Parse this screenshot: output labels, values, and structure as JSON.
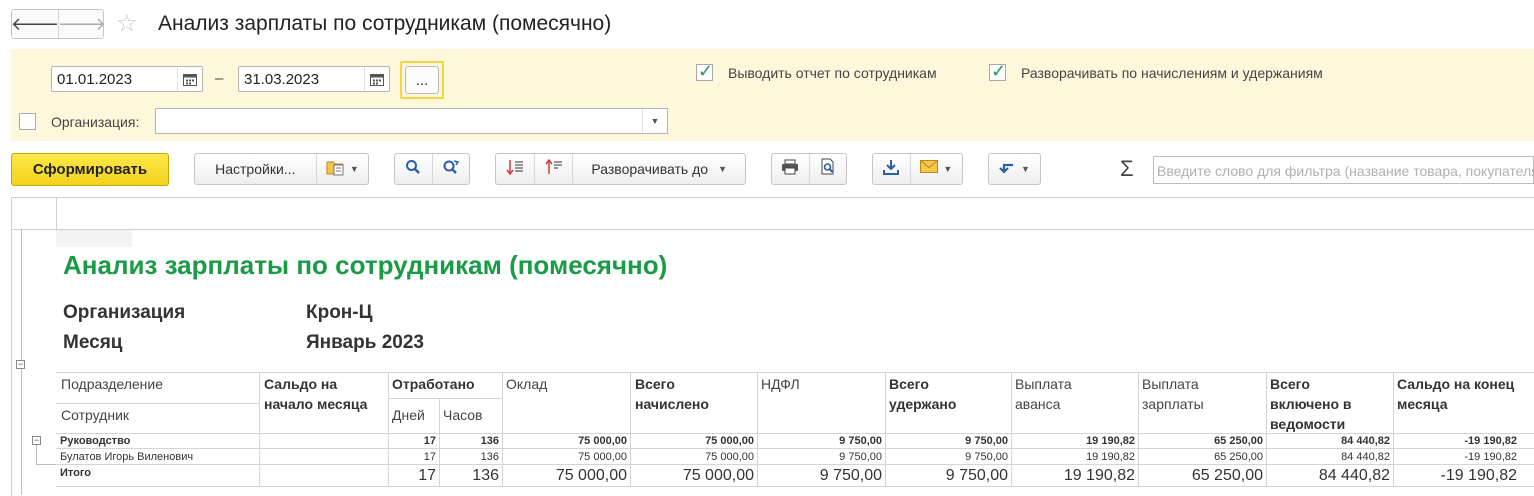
{
  "window": {
    "title": "Анализ зарплаты по сотрудникам (помесячно)"
  },
  "params": {
    "date_from": "01.01.2023",
    "date_sep": "–",
    "date_to": "31.03.2023",
    "dots_label": "...",
    "show_by_employees": {
      "label": "Выводить отчет по сотрудникам",
      "checked": true
    },
    "expand_accruals": {
      "label": "Разворачивать по начислениям и удержаниям",
      "checked": true
    },
    "organization": {
      "label": "Организация:",
      "checked": false,
      "value": ""
    }
  },
  "toolbar": {
    "form_label": "Сформировать",
    "settings_label": "Настройки...",
    "expand_to_label": "Разворачивать до",
    "sigma": "Σ",
    "search_placeholder": "Введите слово для фильтра (название товара, покупателя и т.п.)"
  },
  "report": {
    "title": "Анализ зарплаты по сотрудникам (помесячно)",
    "org_label": "Организация",
    "org_value": "Крон-Ц",
    "month_label": "Месяц",
    "month_value": "Январь 2023",
    "headers": {
      "division": "Подразделение",
      "employee": "Сотрудник",
      "saldo_start": "Сальдо на начало месяца",
      "worked": "Отработано",
      "days": "Дней",
      "hours": "Часов",
      "salary": "Оклад",
      "total_accrued": "Всего начислено",
      "ndfl": "НДФЛ",
      "total_withheld": "Всего удержано",
      "advance": "Выплата аванса",
      "salary_payment": "Выплата зарплаты",
      "total_statement": "Всего включено в ведомости",
      "saldo_end": "Сальдо на конец месяца"
    },
    "rows": [
      {
        "name": "Руководство",
        "days": "17",
        "hours": "136",
        "salary": "75 000,00",
        "accrued": "75 000,00",
        "ndfl": "9 750,00",
        "withheld": "9 750,00",
        "advance": "19 190,82",
        "payment": "65 250,00",
        "statement": "84 440,82",
        "saldo_end": "-19 190,82"
      },
      {
        "name": "Булатов Игорь Виленович",
        "days": "17",
        "hours": "136",
        "salary": "75 000,00",
        "accrued": "75 000,00",
        "ndfl": "9 750,00",
        "withheld": "9 750,00",
        "advance": "19 190,82",
        "payment": "65 250,00",
        "statement": "84 440,82",
        "saldo_end": "-19 190,82"
      },
      {
        "name": "Итого",
        "days": "17",
        "hours": "136",
        "salary": "75 000,00",
        "accrued": "75 000,00",
        "ndfl": "9 750,00",
        "withheld": "9 750,00",
        "advance": "19 190,82",
        "payment": "65 250,00",
        "statement": "84 440,82",
        "saldo_end": "-19 190,82"
      }
    ]
  },
  "colors": {
    "accent_yellow": "#f2d21c",
    "panel_bg": "#fdf8dc",
    "report_title": "#1a9b46",
    "check_green": "#1e9b57"
  }
}
